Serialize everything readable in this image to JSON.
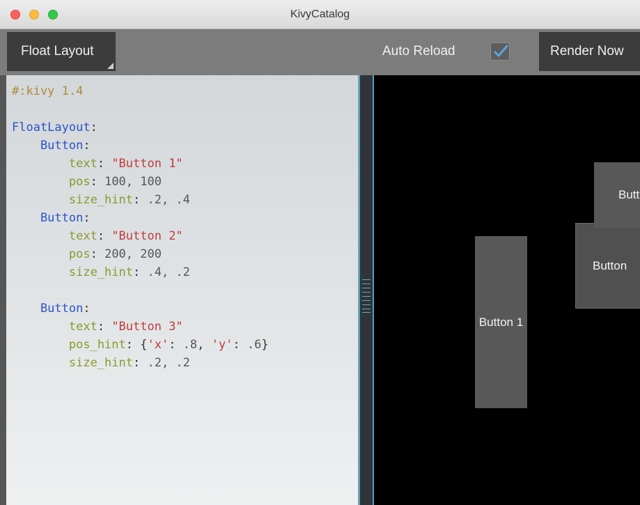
{
  "window": {
    "title": "KivyCatalog"
  },
  "toolbar": {
    "layout_spinner_label": "Float Layout",
    "auto_reload_label": "Auto Reload",
    "auto_reload_checked": true,
    "render_now_label": "Render Now"
  },
  "editor": {
    "lines": [
      [
        {
          "t": "#:kivy 1.4",
          "c": "comment"
        }
      ],
      [],
      [
        {
          "t": "FloatLayout",
          "c": "class"
        },
        {
          "t": ":",
          "c": "punct"
        }
      ],
      [
        {
          "t": "    Button",
          "c": "class"
        },
        {
          "t": ":",
          "c": "punct"
        }
      ],
      [
        {
          "t": "        text",
          "c": "key"
        },
        {
          "t": ": ",
          "c": "punct"
        },
        {
          "t": "\"Button 1\"",
          "c": "str"
        }
      ],
      [
        {
          "t": "        pos",
          "c": "key"
        },
        {
          "t": ": ",
          "c": "punct"
        },
        {
          "t": "100, 100",
          "c": "num"
        }
      ],
      [
        {
          "t": "        size_hint",
          "c": "key"
        },
        {
          "t": ": ",
          "c": "punct"
        },
        {
          "t": ".2, .4",
          "c": "num"
        }
      ],
      [
        {
          "t": "    Button",
          "c": "class"
        },
        {
          "t": ":",
          "c": "punct"
        }
      ],
      [
        {
          "t": "        text",
          "c": "key"
        },
        {
          "t": ": ",
          "c": "punct"
        },
        {
          "t": "\"Button 2\"",
          "c": "str"
        }
      ],
      [
        {
          "t": "        pos",
          "c": "key"
        },
        {
          "t": ": ",
          "c": "punct"
        },
        {
          "t": "200, 200",
          "c": "num"
        }
      ],
      [
        {
          "t": "        size_hint",
          "c": "key"
        },
        {
          "t": ": ",
          "c": "punct"
        },
        {
          "t": ".4, .2",
          "c": "num"
        }
      ],
      [],
      [
        {
          "t": "    Button",
          "c": "class"
        },
        {
          "t": ":",
          "c": "punct"
        }
      ],
      [
        {
          "t": "        text",
          "c": "key"
        },
        {
          "t": ": ",
          "c": "punct"
        },
        {
          "t": "\"Button 3\"",
          "c": "str"
        }
      ],
      [
        {
          "t": "        pos_hint",
          "c": "key"
        },
        {
          "t": ": {",
          "c": "punct"
        },
        {
          "t": "'x'",
          "c": "str"
        },
        {
          "t": ": ",
          "c": "punct"
        },
        {
          "t": ".8",
          "c": "num"
        },
        {
          "t": ", ",
          "c": "punct"
        },
        {
          "t": "'y'",
          "c": "str"
        },
        {
          "t": ": ",
          "c": "punct"
        },
        {
          "t": ".6",
          "c": "num"
        },
        {
          "t": "}",
          "c": "punct"
        }
      ],
      [
        {
          "t": "        size_hint",
          "c": "key"
        },
        {
          "t": ": ",
          "c": "punct"
        },
        {
          "t": ".2, .2",
          "c": "num"
        }
      ]
    ]
  },
  "render": {
    "button1_label": "Button 1",
    "button2_label": "Button",
    "button3_label": "Button"
  },
  "colors": {
    "toolbar_bg": "#7c7c7c",
    "button_bg": "#3c3c3c",
    "render_bg": "#000000",
    "kivy_button_bg": "#585858",
    "splitter_accent": "#4aa3c8"
  }
}
